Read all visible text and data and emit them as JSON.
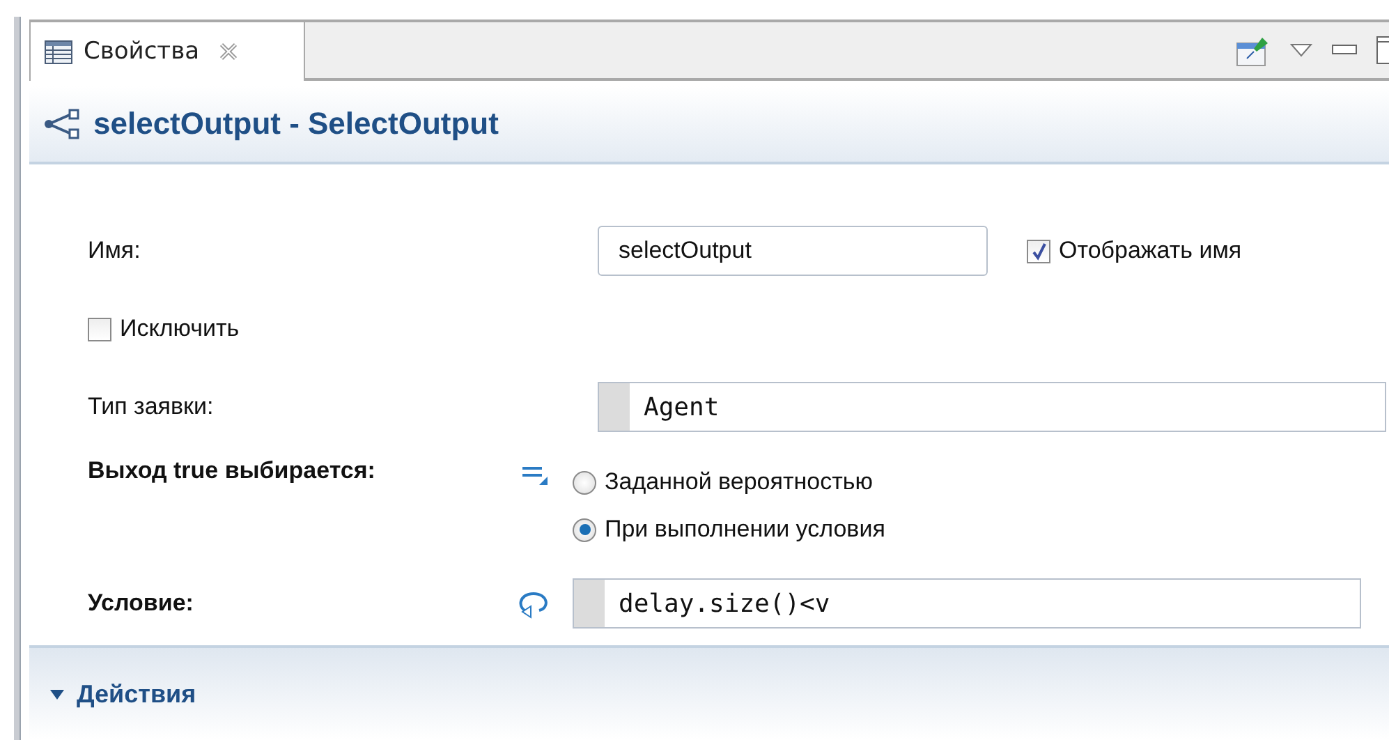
{
  "tabs": [
    {
      "label": "Свойства",
      "selected": true
    }
  ],
  "header": {
    "title": "selectOutput - SelectOutput"
  },
  "name_row": {
    "label": "Имя:",
    "value": "selectOutput",
    "show_name": {
      "label": "Отображать имя",
      "checked": true
    }
  },
  "exclude": {
    "label": "Исключить",
    "checked": false
  },
  "agent_type": {
    "label": "Тип заявки:",
    "value": "Agent"
  },
  "true_output": {
    "label": "Выход true выбирается:",
    "options": [
      {
        "label": "Заданной вероятностью",
        "selected": false
      },
      {
        "label": "При выполнении условия",
        "selected": true
      }
    ]
  },
  "condition": {
    "label": "Условие:",
    "value": "delay.size()<v"
  },
  "sections": [
    {
      "title": "Действия",
      "expanded": true
    }
  ]
}
